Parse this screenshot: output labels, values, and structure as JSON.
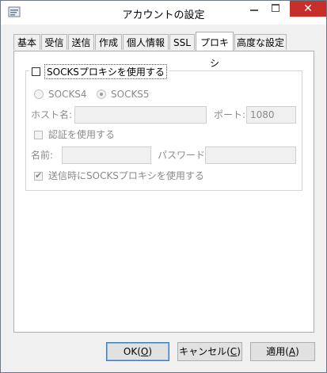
{
  "window": {
    "title": "アカウントの設定",
    "close_glyph": "✕"
  },
  "tabs": [
    {
      "label": "基本",
      "active": false
    },
    {
      "label": "受信",
      "active": false
    },
    {
      "label": "送信",
      "active": false
    },
    {
      "label": "作成",
      "active": false
    },
    {
      "label": "個人情報",
      "active": false
    },
    {
      "label": "SSL",
      "active": false
    },
    {
      "label": "プロキシ",
      "active": true
    },
    {
      "label": "高度な設定",
      "active": false
    }
  ],
  "proxy": {
    "use_socks_label": "SOCKSプロキシを使用する",
    "use_socks_checked": false,
    "socks4_label": "SOCKS4",
    "socks5_label": "SOCKS5",
    "socks5_selected": true,
    "host_label": "ホスト名:",
    "host_value": "",
    "port_label": "ポート:",
    "port_value": "1080",
    "use_auth_label": "認証を使用する",
    "use_auth_checked": false,
    "name_label": "名前:",
    "name_value": "",
    "password_label": "パスワード:",
    "password_value": "",
    "send_via_socks_label": "送信時にSOCKSプロキシを使用する",
    "send_via_socks_checked": true
  },
  "buttons": {
    "ok": {
      "text": "OK(",
      "key": "O",
      "end": ")"
    },
    "cancel": {
      "text": "キャンセル(",
      "key": "C",
      "end": ")"
    },
    "apply": {
      "text": "適用(",
      "key": "A",
      "end": ")"
    }
  }
}
